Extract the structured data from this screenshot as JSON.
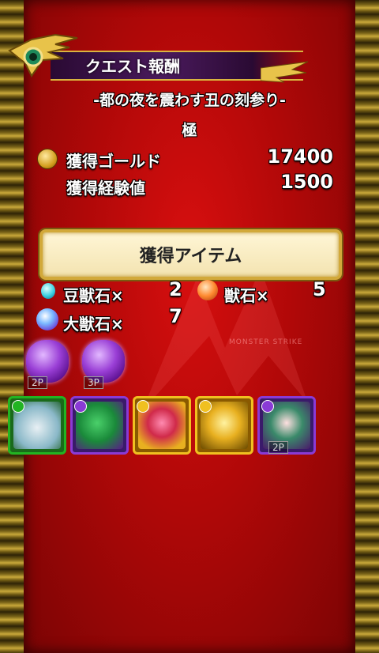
{
  "header": {
    "title": "クエスト報酬"
  },
  "quest": {
    "name": "-都の夜を震わす丑の刻参り-",
    "difficulty": "極"
  },
  "rewards": {
    "gold_label": "獲得ゴールド",
    "gold_value": "17400",
    "exp_label": "獲得経験値",
    "exp_value": "1500"
  },
  "items_section": {
    "title": "獲得アイテム"
  },
  "items": [
    {
      "label": "豆獣石×",
      "count": "2",
      "icon": "small-orb-icon"
    },
    {
      "label": "獣石×",
      "count": "5",
      "icon": "orb-icon"
    },
    {
      "label": "大獣石×",
      "count": "7",
      "icon": "large-orb-icon"
    }
  ],
  "eggs": [
    {
      "tag": "2P",
      "icon": "purple-egg-icon"
    },
    {
      "tag": "3P",
      "icon": "purple-egg-icon"
    }
  ],
  "monsters": [
    {
      "element": "wood",
      "color": "#22b422",
      "icon": "ghost-monster-icon"
    },
    {
      "element": "dark",
      "color": "#8a3ad6",
      "icon": "lizard-monster-icon"
    },
    {
      "element": "light",
      "color": "#f0c020",
      "icon": "jester-monster-icon"
    },
    {
      "element": "light",
      "color": "#f0c020",
      "icon": "gold-creature-icon"
    },
    {
      "element": "dark",
      "color": "#8a3ad6",
      "icon": "warrior-girl-icon",
      "tag": "2P"
    }
  ],
  "watermark": "MONSTER STRIKE"
}
